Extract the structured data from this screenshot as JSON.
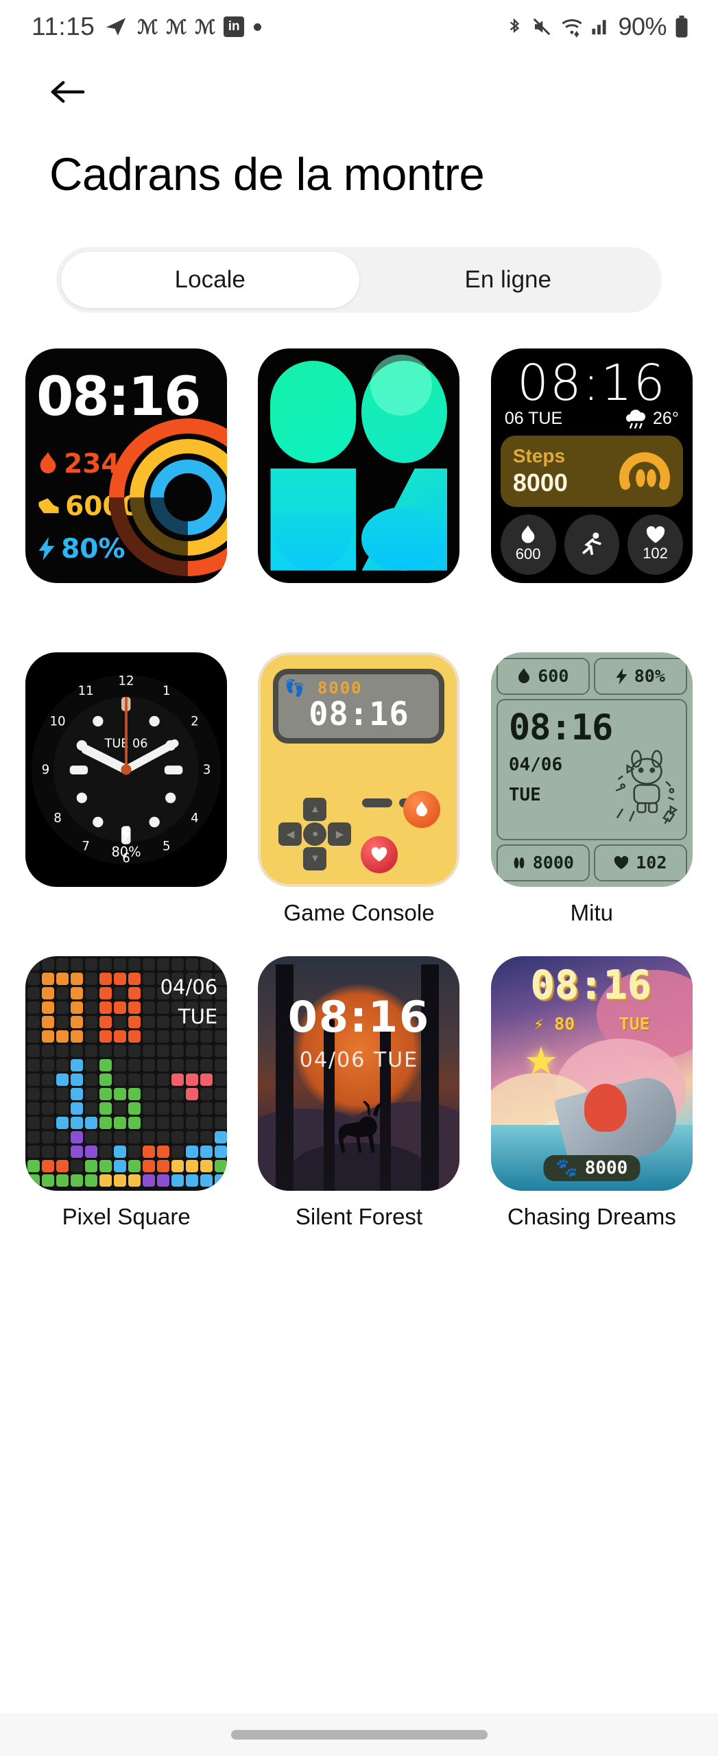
{
  "status_bar": {
    "time": "11:15",
    "left_icons": [
      "telegram-icon",
      "gothic-m-icon",
      "gothic-m-icon",
      "gothic-m-icon",
      "linkedin-icon",
      "dot-icon"
    ],
    "linkedin_label": "in",
    "gothic_glyph": "ℳ",
    "right_icons": [
      "bluetooth-icon",
      "mute-icon",
      "wifi-icon",
      "signal-icon"
    ],
    "battery_percent": "90%"
  },
  "header": {
    "back_label": "←",
    "title": "Cadrans de la montre"
  },
  "tabs": {
    "items": [
      {
        "label": "Locale",
        "active": true
      },
      {
        "label": "En ligne",
        "active": false
      }
    ]
  },
  "watchfaces": [
    {
      "id": "rings-face",
      "name": "",
      "time": "08:16",
      "stats": [
        {
          "icon": "flame-icon",
          "value": "234",
          "color": "#f0511e"
        },
        {
          "icon": "shoe-icon",
          "value": "6000",
          "color": "#fbbd2a"
        },
        {
          "icon": "bolt-icon",
          "value": "80%",
          "color": "#2eb6f2"
        }
      ]
    },
    {
      "id": "gradient-shapes-face",
      "name": "",
      "shapes": [
        "0",
        "8",
        "1",
        "6"
      ],
      "colors": [
        "#16f0a8",
        "#0bd3f5"
      ]
    },
    {
      "id": "steps-card-face",
      "name": "",
      "time": "08:16",
      "date": "06 TUE",
      "weather_icon": "rain-cloud-icon",
      "temperature": "26°",
      "steps_label": "Steps",
      "steps_value": "8000",
      "metrics": [
        {
          "icon": "flame-icon",
          "value": "600"
        },
        {
          "icon": "runner-icon",
          "value": ""
        },
        {
          "icon": "heart-icon",
          "value": "102"
        }
      ]
    },
    {
      "id": "analog-face",
      "name": "",
      "date": "TUE  06",
      "battery": "80%",
      "hour_numbers": [
        "12",
        "1",
        "2",
        "3",
        "4",
        "5",
        "6",
        "7",
        "8",
        "9",
        "10",
        "11"
      ]
    },
    {
      "id": "game-console-face",
      "name": "Game Console",
      "time": "08:16",
      "steps": "8000",
      "steps_icon": "footprints-icon",
      "button_a_icon": "flame-icon",
      "button_b_icon": "heart-icon"
    },
    {
      "id": "mitu-face",
      "name": "Mitu",
      "time": "08:16",
      "date": "04/06",
      "weekday": "TUE",
      "top_left": {
        "icon": "flame-icon",
        "value": "600"
      },
      "top_right": {
        "icon": "bolt-icon",
        "value": "80%"
      },
      "bottom_left": {
        "icon": "footprints-icon",
        "value": "8000"
      },
      "bottom_right": {
        "icon": "heart-icon",
        "value": "102"
      }
    },
    {
      "id": "pixel-square-face",
      "name": "Pixel Square",
      "time": "08:16",
      "date": "04/06",
      "weekday": "TUE"
    },
    {
      "id": "silent-forest-face",
      "name": "Silent Forest",
      "time": "08:16",
      "date": "04/06 TUE"
    },
    {
      "id": "chasing-dreams-face",
      "name": "Chasing Dreams",
      "time": "08:16",
      "battery": "80",
      "battery_icon": "bolt-icon",
      "weekday": "TUE",
      "steps": "8000",
      "steps_icon": "paw-icon"
    }
  ],
  "theme": {
    "background": "#ffffff",
    "tab_track": "#f2f2f2",
    "tab_active": "#ffffff",
    "text": "#000000",
    "nav_pill": "#b4b4b4"
  }
}
